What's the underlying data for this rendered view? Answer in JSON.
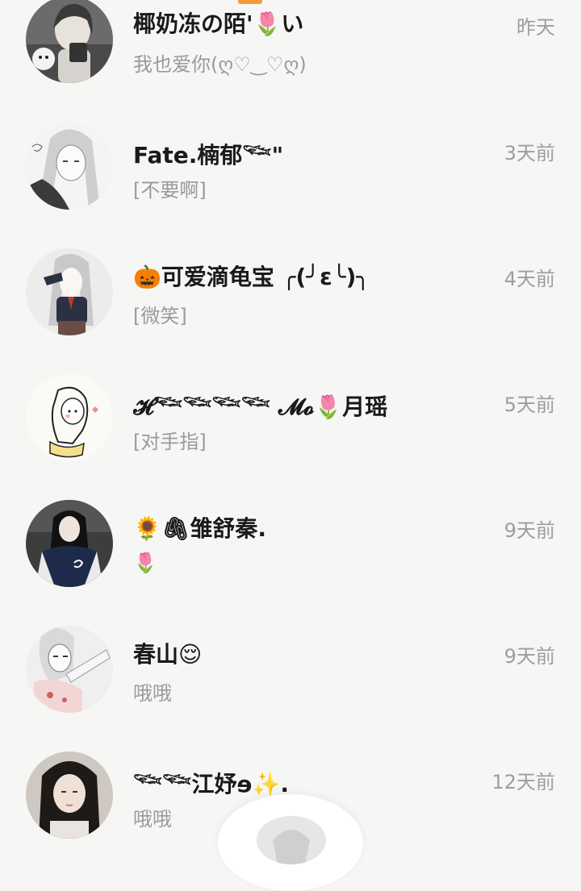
{
  "conversations": [
    {
      "name": "椰奶冻の陌'🌷い",
      "preview": "我也爱你(ღ♡‿♡ღ)",
      "time": "昨天",
      "avatar_icon": "girl-car-avatar"
    },
    {
      "name": "Fate.楠郁𓆝\"",
      "preview": "[不要啊]",
      "time": "3天前",
      "avatar_icon": "sketch-girl-avatar"
    },
    {
      "name": "🎃可爱滴龟宝 ╭(╯ε╰)╮",
      "preview": "[微笑]",
      "time": "4天前",
      "avatar_icon": "uniform-girl-avatar"
    },
    {
      "name": "𝓗𓆝𓆝𓆝𓆝 𝓜𝓸🌷月瑶",
      "preview": "[对手指]",
      "time": "5天前",
      "avatar_icon": "cartoon-girl-avatar"
    },
    {
      "name": "🌻🖇雏舒秦.",
      "preview": "🌷",
      "time": "9天前",
      "avatar_icon": "jacket-girl-avatar"
    },
    {
      "name": "春山😌",
      "preview": "哦哦",
      "time": "9天前",
      "avatar_icon": "anime-girl-avatar"
    },
    {
      "name": "𓆝𓆝江妤ɘ✨.",
      "preview": "哦哦",
      "time": "12天前",
      "avatar_icon": "photo-girl-avatar"
    }
  ],
  "colors": {
    "background": "#f6f6f4",
    "name_text": "#1a1a1a",
    "secondary_text": "#9a9a9a",
    "accent": "#f59a3a"
  }
}
